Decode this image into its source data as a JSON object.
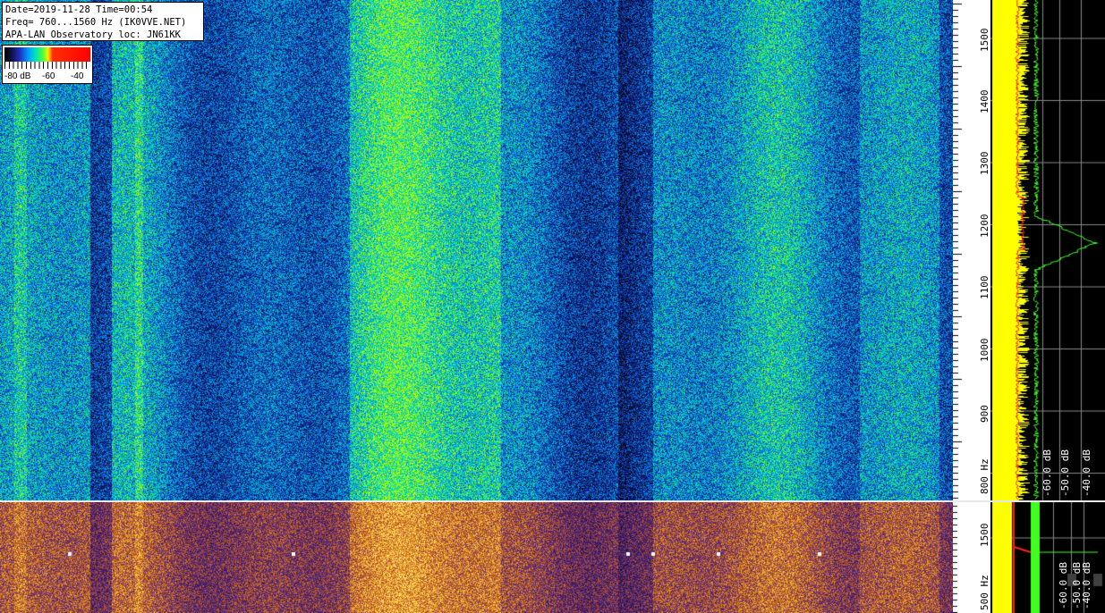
{
  "info": {
    "line1": "Date=2019-11-28 Time=00:54",
    "line2": "Freq= 760...1560 Hz (IK0VVE.NET)",
    "line3": "APA-LAN Observatory loc: JN61KK"
  },
  "legend": {
    "labels": [
      "-80 dB",
      "-60",
      "-40"
    ],
    "icon": "color-scale-icon"
  },
  "axis_main": {
    "ticks": [
      "1500",
      "1400",
      "1300",
      "1200",
      "1100",
      "1000",
      "900",
      "800 Hz"
    ]
  },
  "axis_sub": {
    "ticks": [
      "1500",
      "500 Hz"
    ]
  },
  "spectrum_main": {
    "db_labels": [
      "-60.0 dB",
      "-50.0 dB",
      "-40.0 dB"
    ]
  },
  "spectrum_sub": {
    "db_labels": [
      "-60.0 dB",
      "-50.0 dB",
      "-40.0 dB"
    ]
  },
  "colors": {
    "waterfall_blue": "#0a2f8a",
    "signal_red": "#ff1010",
    "trace_yellow": "#ffff00",
    "trace_green": "#40ff20",
    "sub_orange": "#d08020"
  }
}
